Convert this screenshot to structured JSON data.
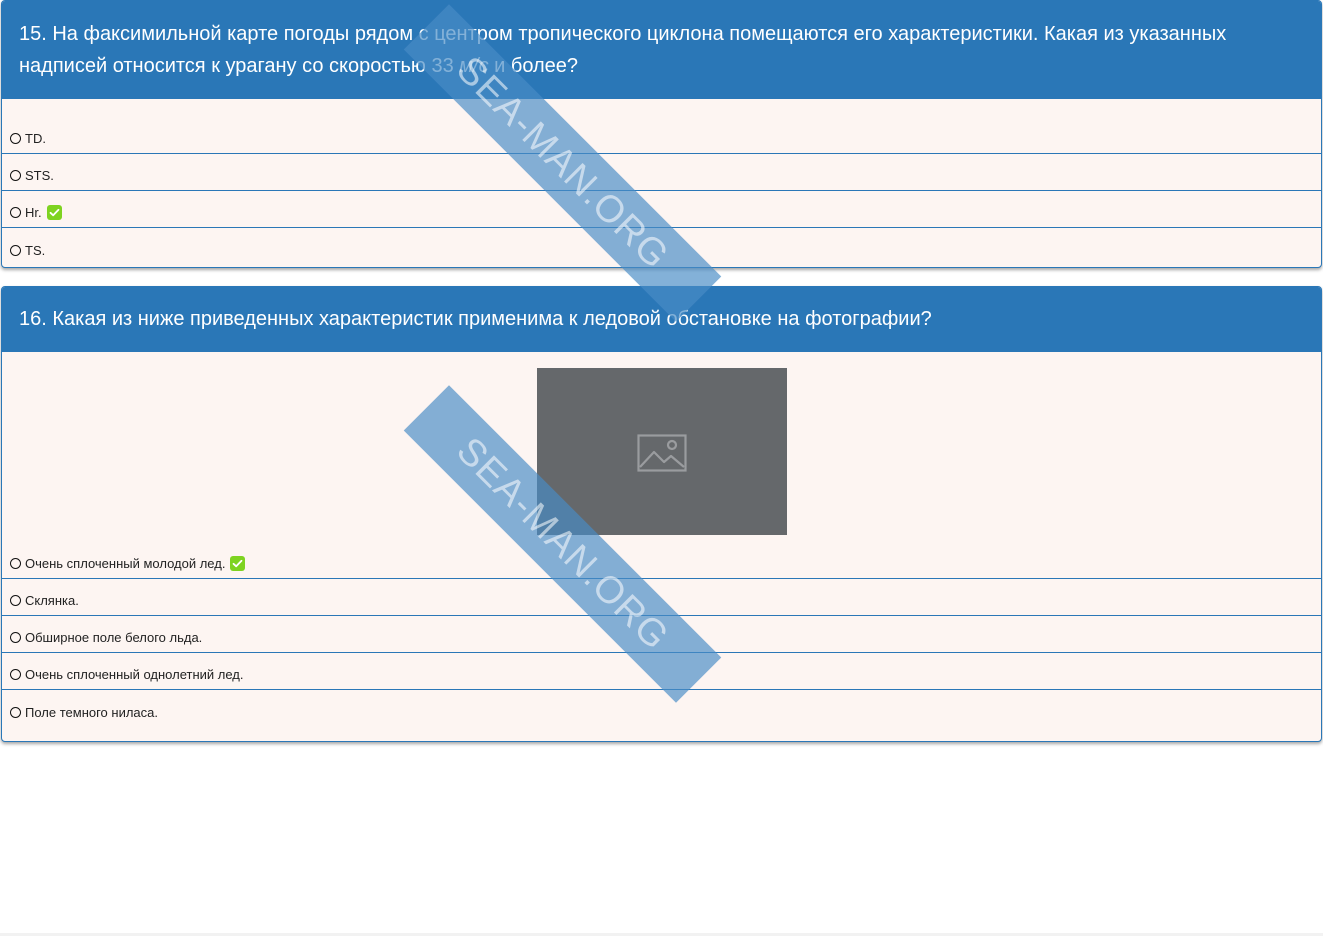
{
  "questions": [
    {
      "title_prefix": "15. На факсимильной карте погоды рядом с центром тропического циклона помещаются его характеристики. Какая из указанных надписей относится к урагану со скоростью 33 ",
      "title_unit": "м/с",
      "title_suffix": " и более?",
      "options": [
        {
          "label": "TD.",
          "correct": false
        },
        {
          "label": "STS.",
          "correct": false
        },
        {
          "label": "Hr.",
          "correct": true
        },
        {
          "label": "TS.",
          "correct": false
        }
      ]
    },
    {
      "title": "16. Какая из ниже приведенных характеристик применима к ледовой обстановке на фотографии?",
      "image_icon": "image-placeholder-icon",
      "options": [
        {
          "label": "Очень сплоченный молодой лед.",
          "correct": true
        },
        {
          "label": "Склянка.",
          "correct": false
        },
        {
          "label": "Обширное поле белого льда.",
          "correct": false
        },
        {
          "label": "Очень сплоченный однолетний лед.",
          "correct": false
        },
        {
          "label": "Поле темного ниласа.",
          "correct": false
        }
      ]
    }
  ],
  "watermark": "SEA-MAN.ORG",
  "colors": {
    "header_bg": "#2a77b7",
    "card_bg": "#fdf5f2",
    "correct_badge": "#7ed321",
    "image_placeholder": "#65686b"
  }
}
